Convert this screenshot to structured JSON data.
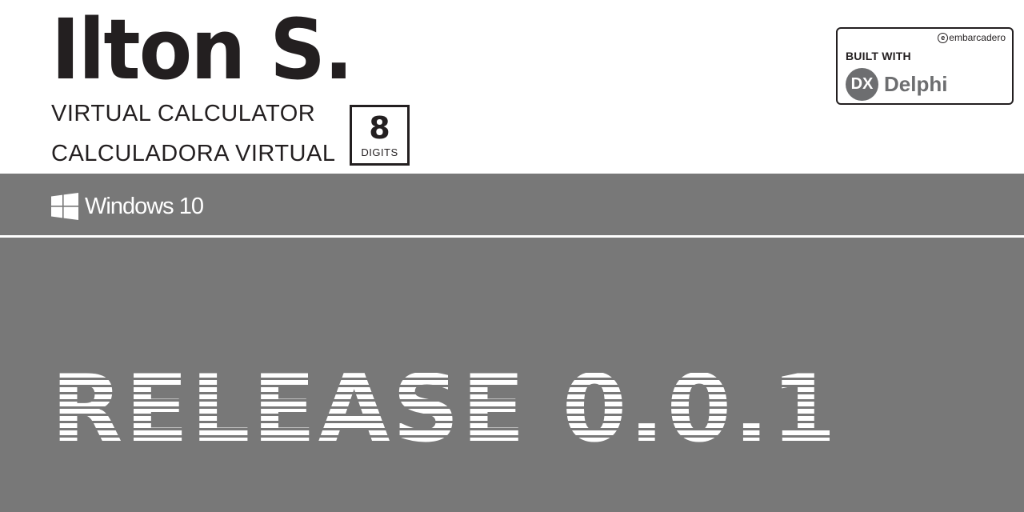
{
  "header": {
    "title": "Ilton S.",
    "subtitle_en": "VIRTUAL CALCULATOR",
    "subtitle_pt": "CALCULADORA VIRTUAL",
    "digits_badge": {
      "value": "8",
      "label": "DIGITS"
    }
  },
  "built_badge": {
    "vendor": "embarcadero",
    "vendor_icon": "embarcadero-e-icon",
    "built_with": "BUILT WITH",
    "product_icon": "dx-icon",
    "product_icon_text": "DX",
    "product": "Delphi"
  },
  "os_band": {
    "icon": "windows-logo-icon",
    "label": "Windows 10"
  },
  "release": {
    "label": "RELEASE 0.0.1"
  },
  "colors": {
    "band_gray": "#787878",
    "text_dark": "#231f20",
    "delphi_gray": "#6d6e70",
    "white": "#ffffff"
  }
}
